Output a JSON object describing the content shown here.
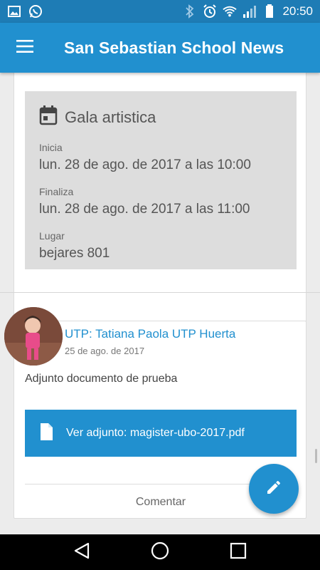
{
  "status_bar": {
    "time": "20:50",
    "left_icons": [
      "image-icon",
      "whatsapp-icon"
    ],
    "right_icons": [
      "bluetooth-icon",
      "alarm-icon",
      "wifi-icon",
      "signal-icon",
      "battery-icon"
    ]
  },
  "app_bar": {
    "title": "San Sebastian School News",
    "menu_icon": "hamburger-menu-icon"
  },
  "event_card": {
    "title": "Gala artistica",
    "icon": "calendar-icon",
    "start_label": "Inicia",
    "start_value": "lun. 28 de ago. de 2017 a las 10:00",
    "end_label": "Finaliza",
    "end_value": "lun. 28 de ago. de 2017 a las 11:00",
    "place_label": "Lugar",
    "place_value": "bejares 801"
  },
  "post_card": {
    "author": "UTP: Tatiana Paola UTP Huerta",
    "date": "25 de ago. de 2017",
    "body": "Adjunto documento de prueba",
    "attachment_label": "Ver adjunto: magister-ubo-2017.pdf",
    "attachment_icon": "document-icon",
    "comment_label": "Comentar"
  },
  "fab": {
    "icon": "pencil-icon"
  },
  "nav_bar": {
    "icons": [
      "back-icon",
      "home-icon",
      "recents-icon"
    ]
  },
  "colors": {
    "status_bar": "#1e7cb5",
    "primary": "#2190cf",
    "event_box": "#dddddd",
    "background": "#ececec"
  }
}
